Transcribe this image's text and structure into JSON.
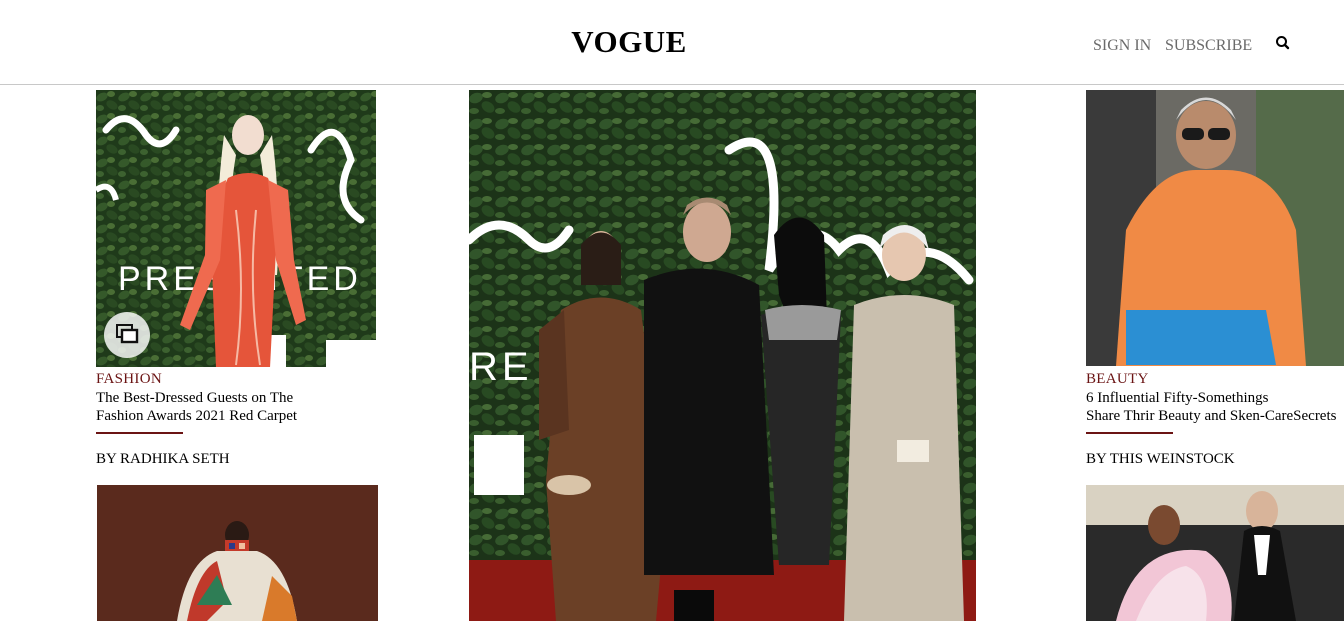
{
  "header": {
    "logo": "VOGUE",
    "sign_in": "SIGN IN",
    "subscribe": "SUBSCRIBE",
    "search_icon": "search-icon"
  },
  "articles": {
    "left": {
      "category": "FASHION",
      "headline_line1": "The Best-Dressed Guests on The",
      "headline_line2": "Fashion Awards 2021 Red Carpet",
      "byline": "BY RADHIKA SETH",
      "image_text": "PRESENTED",
      "badge_icon": "gallery-icon"
    },
    "center": {
      "image_text": "RE"
    },
    "right": {
      "category": "BEAUTY",
      "headline_line1": "6 Influential Fifty-Somethings",
      "headline_line2": "Share Thrir Beauty and Sken-CareSecrets",
      "byline": "BY THIS WEINSTOCK"
    }
  },
  "colors": {
    "accent": "#6b1414",
    "nav_text": "#6a6a6a",
    "divider": "#c8c8c8"
  }
}
